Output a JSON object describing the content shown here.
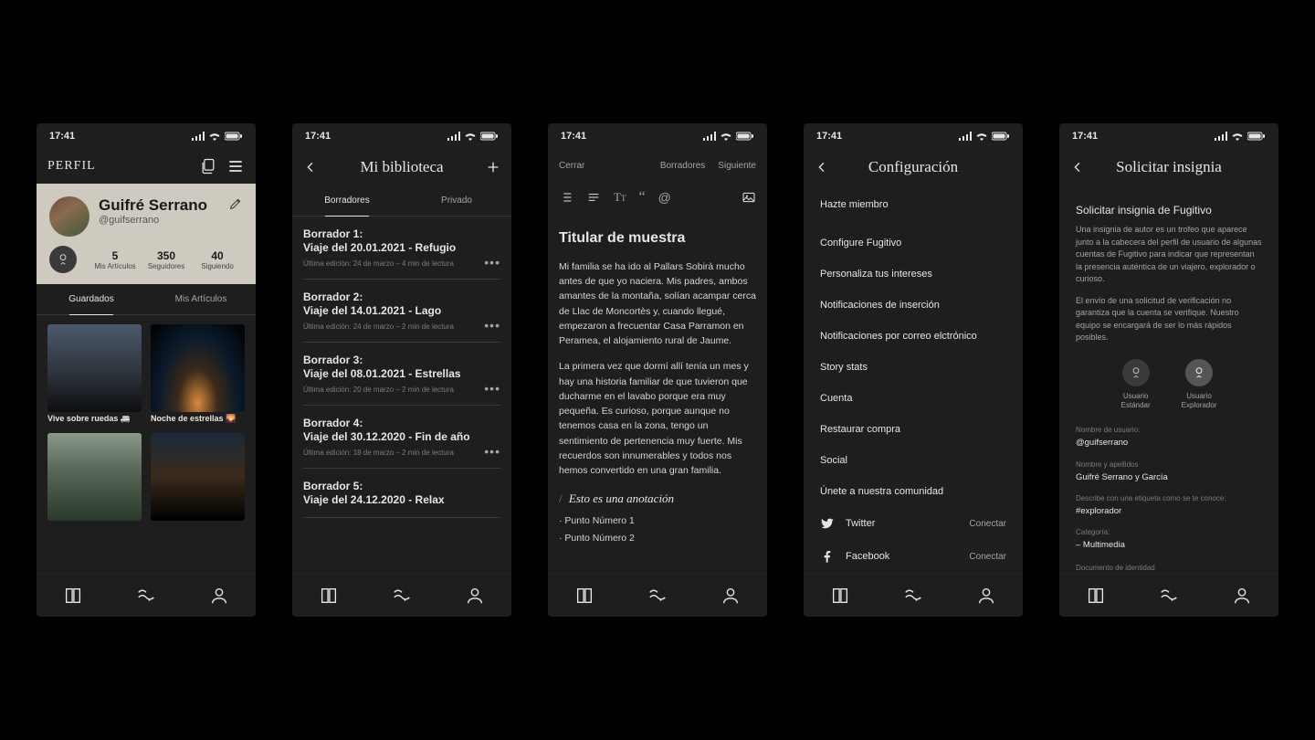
{
  "status": {
    "time": "17:41"
  },
  "screen1": {
    "header_title": "PERFIL",
    "name": "Guifré Serrano",
    "handle": "@guifserrano",
    "stats": [
      {
        "n": "5",
        "l": "Mis Artículos"
      },
      {
        "n": "350",
        "l": "Seguidores"
      },
      {
        "n": "40",
        "l": "Siguiendo"
      }
    ],
    "tabs": {
      "saved": "Guardados",
      "mine": "Mis Artículos"
    },
    "captions": {
      "c1": "Vive sobre ruedas 🚐",
      "c2": "Noche de estrellas 🌄"
    }
  },
  "screen2": {
    "title": "Mi biblioteca",
    "tabs": {
      "drafts": "Borradores",
      "private": "Privado"
    },
    "drafts": [
      {
        "label": "Borrador 1:",
        "title": "Viaje del 20.01.2021 - Refugio",
        "meta": "Última edición: 24 de marzo  –  4 min de lectura"
      },
      {
        "label": "Borrador 2:",
        "title": "Viaje del 14.01.2021 - Lago",
        "meta": "Última edición: 24 de marzo  –  2 min de lectura"
      },
      {
        "label": "Borrador 3:",
        "title": "Viaje del 08.01.2021 - Estrellas",
        "meta": "Última edición: 20 de marzo  –  2 min de lectura"
      },
      {
        "label": "Borrador 4:",
        "title": "Viaje del 30.12.2020 - Fin de año",
        "meta": "Última edición: 18 de marzo  –  2 min de lectura"
      },
      {
        "label": "Borrador 5:",
        "title": "Viaje del 24.12.2020 - Relax",
        "meta": ""
      }
    ]
  },
  "screen3": {
    "close": "Cerrar",
    "drafts": "Borradores",
    "next": "Siguiente",
    "h1": "Titular de muestra",
    "p1": "Mi familia se ha ido al Pallars Sobirà mucho antes de que yo naciera. Mis padres, ambos amantes de la montaña, solían acampar cerca de Llac de Moncortès y, cuando llegué, empezaron a frecuentar Casa Parramon en Peramea, el alojamiento rural de Jaume.",
    "p2": "La primera vez que dormí allí tenía un mes y hay una historia familiar de que tuvieron que ducharme en el lavabo porque era muy pequeña. Es curioso, porque aunque no tenemos casa en la zona, tengo un sentimiento de pertenencia muy fuerte. Mis recuerdos son innumerables y todos nos hemos convertido en una gran familia.",
    "quote": "Esto es una anotación",
    "li1": "Punto Número 1",
    "li2": "Punto Número 2"
  },
  "screen4": {
    "title": "Configuración",
    "items": [
      "Hazte miembro",
      "Configure Fugitivo",
      "Personaliza tus intereses",
      "Notificaciones de inserción",
      "Notificaciones por correo elctrónico",
      "Story stats",
      "Cuenta",
      "Restaurar compra",
      "Social",
      "Únete a nuestra comunidad"
    ],
    "social": {
      "twitter": "Twitter",
      "facebook": "Facebook",
      "connect": "Conectar"
    }
  },
  "screen5": {
    "title": "Solicitar insignia",
    "h": "Solicitar insignia de Fugitivo",
    "p1": "Una insignia de autor es un trofeo que aparece junto a la cabecera del perfil de usuario de algunas cuentas de Fugitivo para indicar que representan la presencia auténtica de un viajero, explorador o curioso.",
    "p2": "El envío de una solicitud de verificación no garantiza que la cuenta se verifique. Nuestro equipo se encargará de ser lo más rápidos posibles.",
    "badge1": "Usuario\nEstándar",
    "badge2": "Usuario\nExplorador",
    "f1l": "Nombre de usuario:",
    "f1v": "@guifserrano",
    "f2l": "Nombre y apellidos",
    "f2v": "Guifré Serrano y García",
    "f3l": "Describe con una etiqueta como se te conoce:",
    "f3v": "#explorador",
    "f4l": "Categoría:",
    "f4v": "– Multimedia",
    "f5l": "Documento de identidad"
  }
}
